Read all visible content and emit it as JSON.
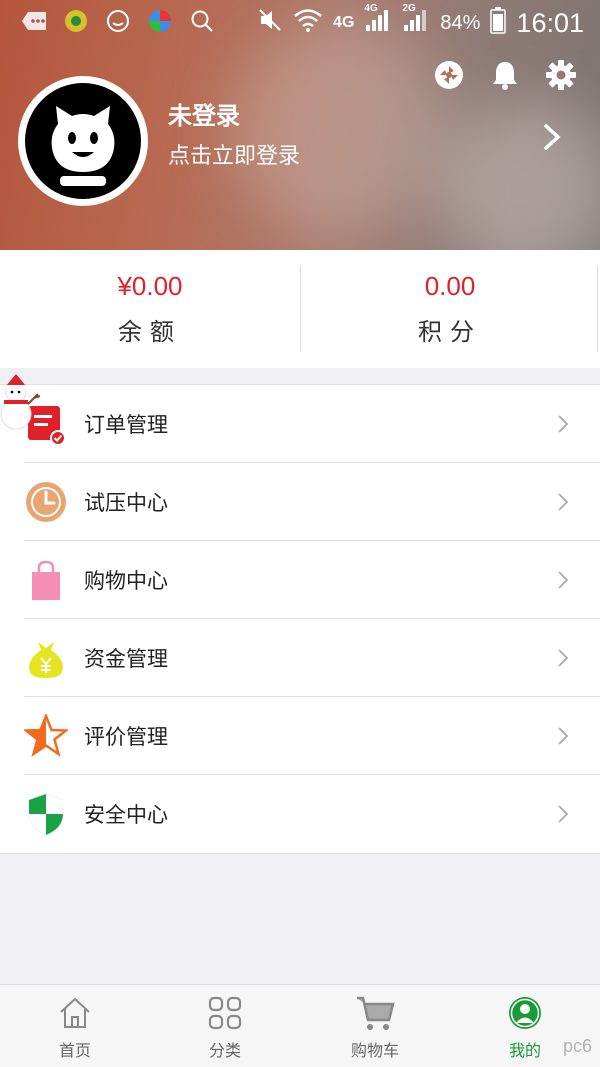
{
  "status_bar": {
    "network": "4G",
    "sim1": "4G",
    "sim2": "2G",
    "battery": "84%",
    "time": "16:01"
  },
  "header": {
    "user_name": "未登录",
    "user_subtitle": "点击立即登录",
    "icons": [
      "shutter-icon",
      "bell-icon",
      "gear-icon"
    ]
  },
  "stats": [
    {
      "value": "¥0.00",
      "label": "余额"
    },
    {
      "value": "0.00",
      "label": "积分"
    }
  ],
  "menu": [
    {
      "label": "订单管理",
      "icon": "order-icon",
      "color": "#e0212a"
    },
    {
      "label": "试压中心",
      "icon": "clock-icon",
      "color": "#e9a56f"
    },
    {
      "label": "购物中心",
      "icon": "shopping-bag-icon",
      "color": "#f58eb5"
    },
    {
      "label": "资金管理",
      "icon": "money-bag-icon",
      "color": "#e4e421"
    },
    {
      "label": "评价管理",
      "icon": "star-icon",
      "color": "#f26b1d"
    },
    {
      "label": "安全中心",
      "icon": "shield-icon",
      "color": "#1aa345"
    }
  ],
  "bottom_nav": [
    {
      "label": "首页",
      "icon": "home-icon"
    },
    {
      "label": "分类",
      "icon": "grid-icon"
    },
    {
      "label": "购物车",
      "icon": "cart-icon"
    },
    {
      "label": "我的",
      "icon": "user-icon",
      "active": true
    }
  ],
  "watermark": "pc6",
  "colors": {
    "accent_red": "#e0212a",
    "active_green": "#1a9b3a"
  }
}
